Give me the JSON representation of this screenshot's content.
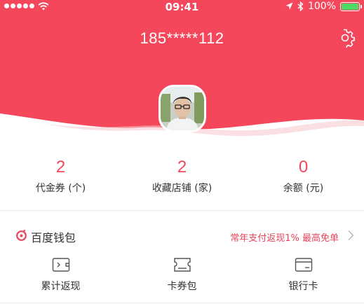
{
  "status_bar": {
    "time": "09:41",
    "battery_percent": "100%",
    "battery_level": 1.0,
    "signal_bars": 5
  },
  "profile": {
    "phone_masked": "185*****112",
    "settings_icon": "gear-icon",
    "avatar_icon": "user-avatar"
  },
  "stats": [
    {
      "value": "2",
      "label": "代金券 (个)"
    },
    {
      "value": "2",
      "label": "收藏店铺 (家)"
    },
    {
      "value": "0",
      "label": "余额 (元)"
    }
  ],
  "wallet": {
    "title": "百度钱包",
    "promo": "常年支付返现1% 最高免单",
    "logo_icon": "baidu-wallet-logo",
    "chevron_icon": "chevron-right-icon"
  },
  "tools": [
    {
      "label": "累计返现",
      "icon": "cashback-wallet-icon"
    },
    {
      "label": "卡券包",
      "icon": "coupon-ticket-icon"
    },
    {
      "label": "银行卡",
      "icon": "bank-card-icon"
    }
  ],
  "colors": {
    "brand": "#f5475c",
    "accent_text": "#e8455a",
    "battery": "#4cd964"
  }
}
